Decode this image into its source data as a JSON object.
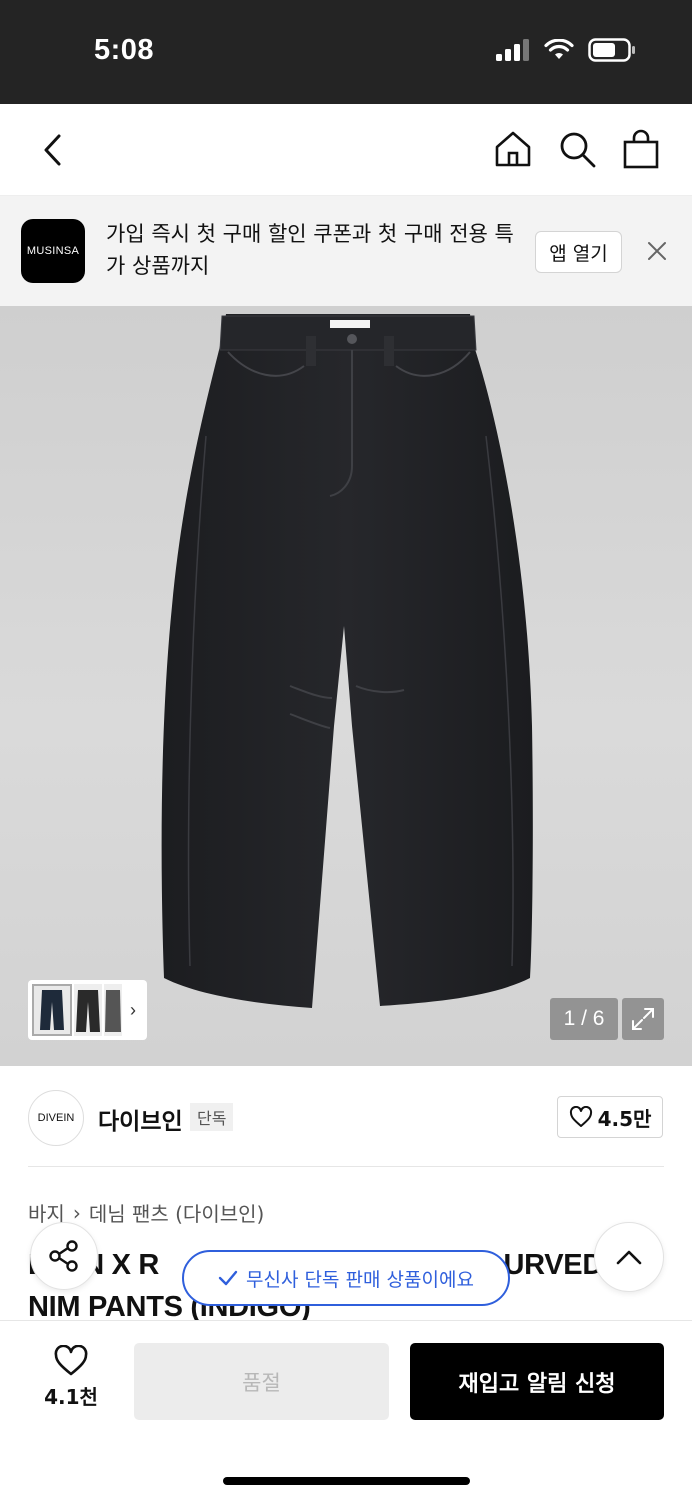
{
  "status_bar": {
    "time": "5:08"
  },
  "app_banner": {
    "logo_text": "MUSINSA",
    "message": "가입 즉시 첫 구매 할인 쿠폰과 첫 구매 전용 특가 상품까지",
    "open_label": "앱 열기"
  },
  "gallery": {
    "page_counter": "1 / 6"
  },
  "brand": {
    "logo_text": "DIVEIN",
    "name": "다이브인",
    "badge": "단독",
    "likes": "4.5만"
  },
  "breadcrumb": {
    "items": [
      "바지",
      "데님 팬츠 (다이브인)"
    ]
  },
  "product": {
    "title": "DIVEIN X R... CURVED DENIM PANTS (INDIGO)",
    "title_line1": "D   EIN X R",
    "title_line1_end": "URVED",
    "title_line2": "NIM PANTS (INDIGO)"
  },
  "toast": {
    "text": "무신사 단독 판매 상품이에요"
  },
  "bottom_bar": {
    "wish_count": "4.1천",
    "soldout_label": "품절",
    "restock_label": "재입고 알림 신청"
  },
  "colors": {
    "status_bg": "#242424",
    "banner_bg": "#f3f3f3",
    "toast_blue": "#2f5fdc",
    "primary_btn": "#000000",
    "disabled_btn": "#ececec"
  }
}
